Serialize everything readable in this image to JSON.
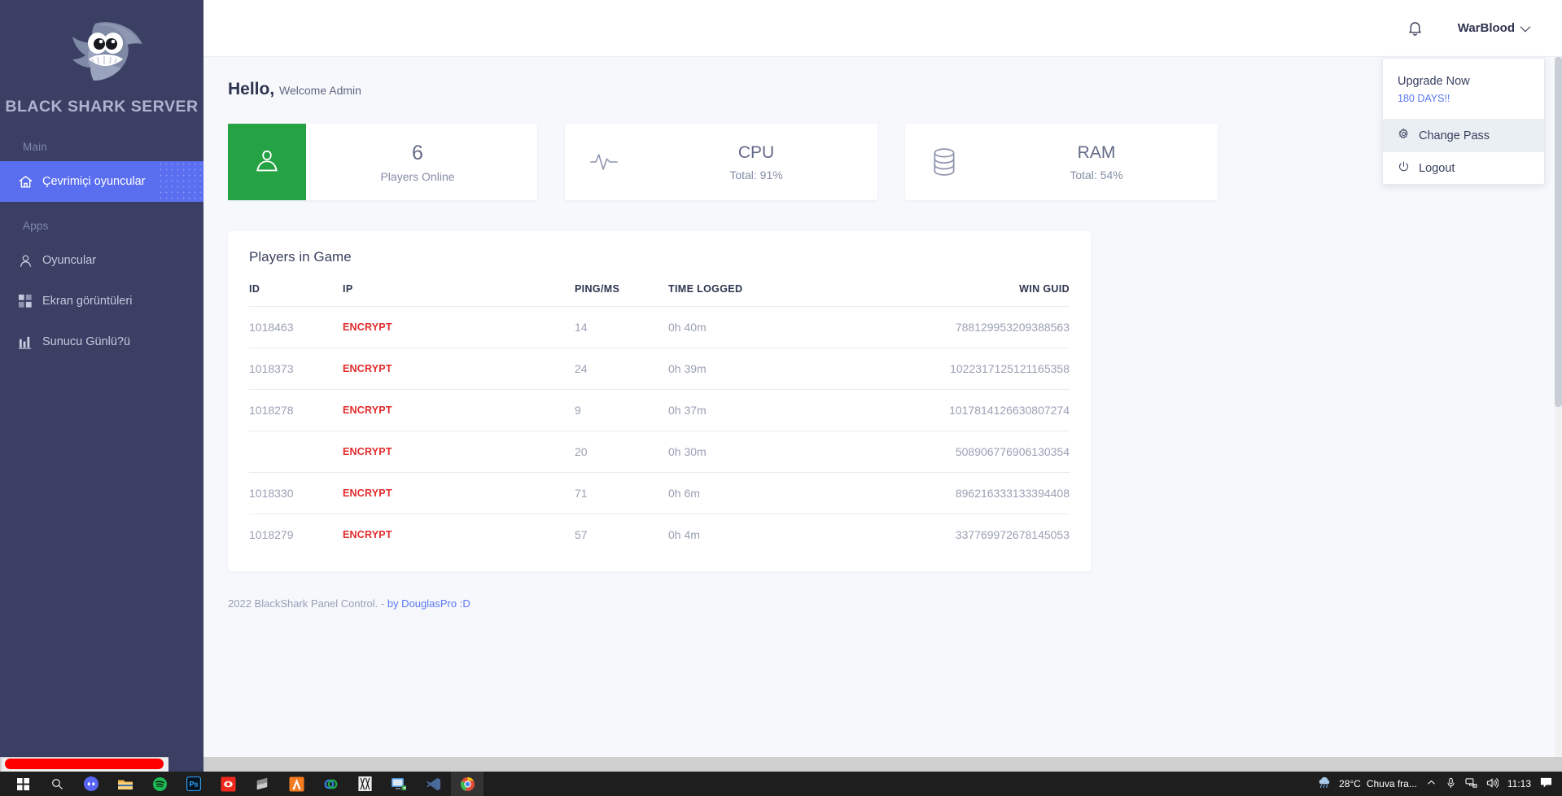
{
  "sidebar": {
    "brand_title": "BLACK SHARK SERVER",
    "logo_icon": "shark-logo-icon",
    "sections": [
      {
        "label": "Main",
        "items": [
          {
            "label": "Çevrimiçi oyuncular",
            "icon": "home-icon",
            "active": true
          }
        ]
      },
      {
        "label": "Apps",
        "items": [
          {
            "label": "Oyuncular",
            "icon": "user-icon",
            "active": false
          },
          {
            "label": "Ekran görüntüleri",
            "icon": "grid-icon",
            "active": false
          },
          {
            "label": "Sunucu Günlü?ü",
            "icon": "bar-chart-icon",
            "active": false
          }
        ]
      }
    ],
    "active_color": "#5a6ef0",
    "background_color": "#3a3f63"
  },
  "topbar": {
    "bell_icon": "notification-bell-icon",
    "username": "WarBlood",
    "caret_icon": "chevron-down-icon"
  },
  "dropdown": {
    "upgrade_title": "Upgrade Now",
    "upgrade_sub": "180 DAYS!!",
    "items": [
      {
        "label": "Change Pass",
        "icon": "gear-icon",
        "hover": true
      },
      {
        "label": "Logout",
        "icon": "power-icon",
        "hover": false
      }
    ]
  },
  "greeting": {
    "bold": "Hello,",
    "rest": "Welcome Admin"
  },
  "cards": [
    {
      "icon": "user-silhouette-icon",
      "icon_style": "green",
      "accent": "#25a244",
      "value": "6",
      "label": "Players Online"
    },
    {
      "icon": "pulse-activity-icon",
      "icon_style": "plain",
      "value": "CPU",
      "label": "Total: 91%"
    },
    {
      "icon": "database-icon",
      "icon_style": "plain",
      "value": "RAM",
      "label": "Total: 54%"
    }
  ],
  "table": {
    "title": "Players in Game",
    "columns": [
      "ID",
      "IP",
      "PING/MS",
      "TIME LOGGED",
      "WIN GUID"
    ],
    "rows": [
      {
        "id": "1018463",
        "ip": "ENCRYPT",
        "ping": "14",
        "time": "0h 40m",
        "guid": "788129953209388563"
      },
      {
        "id": "1018373",
        "ip": "ENCRYPT",
        "ping": "24",
        "time": "0h 39m",
        "guid": "1022317125121165358"
      },
      {
        "id": "1018278",
        "ip": "ENCRYPT",
        "ping": "9",
        "time": "0h 37m",
        "guid": "1017814126630807274"
      },
      {
        "id": "",
        "ip": "ENCRYPT",
        "ping": "20",
        "time": "0h 30m",
        "guid": "508906776906130354"
      },
      {
        "id": "1018330",
        "ip": "ENCRYPT",
        "ping": "71",
        "time": "0h 6m",
        "guid": "896216333133394408"
      },
      {
        "id": "1018279",
        "ip": "ENCRYPT",
        "ping": "57",
        "time": "0h 4m",
        "guid": "337769972678145053"
      }
    ],
    "encrypt_color": "#e22a2a"
  },
  "footer": {
    "text": "2022 BlackShark Panel Control. -",
    "link": "by DouglasPro :D"
  },
  "taskbar": {
    "items": [
      {
        "icon": "windows-start-icon"
      },
      {
        "icon": "search-icon"
      },
      {
        "icon": "discord-icon"
      },
      {
        "icon": "file-explorer-icon"
      },
      {
        "icon": "spotify-icon"
      },
      {
        "icon": "photoshop-icon"
      },
      {
        "icon": "app-red-icon"
      },
      {
        "icon": "sublime-icon"
      },
      {
        "icon": "anaconda-icon"
      },
      {
        "icon": "rings-icon"
      },
      {
        "icon": "app-white-icon"
      },
      {
        "icon": "remote-desktop-icon"
      },
      {
        "icon": "vscode-icon"
      },
      {
        "icon": "chrome-icon"
      }
    ],
    "weather_temp": "28°C",
    "weather_desc": "Chuva fra...",
    "tray_icons": [
      "chevron-up-icon",
      "microphone-icon",
      "network-icon",
      "volume-icon"
    ],
    "time": "11:13",
    "notification_icon": "action-center-icon"
  }
}
